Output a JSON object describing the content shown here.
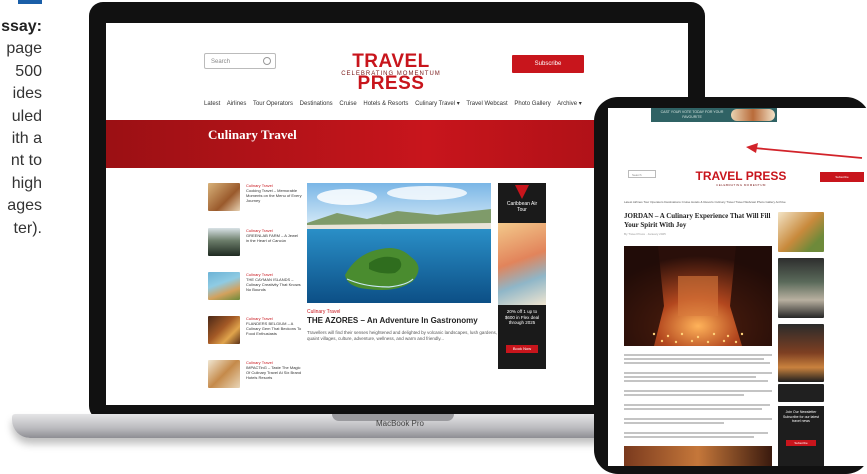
{
  "caption": {
    "lines": [
      "ssay:",
      "page",
      "500",
      "ides",
      "uled",
      "ith a",
      "nt to",
      "high",
      "ages",
      "ter)."
    ]
  },
  "laptop": {
    "model_label": "MacBook Pro",
    "screen": {
      "search_placeholder": "Search",
      "logo": "TRAVEL PRESS",
      "tagline": "CELEBRATING MOMENTUM",
      "subscribe_label": "Subscribe",
      "nav": [
        "Latest",
        "Airlines",
        "Tour Operators",
        "Destinations",
        "Cruise",
        "Hotels & Resorts",
        "Culinary Travel ▾",
        "Travel Webcast",
        "Photo Gallery",
        "Archive ▾"
      ],
      "section_title": "Culinary Travel",
      "items": [
        {
          "category": "Culinary Travel",
          "title": "Cooking Travel – Memorable Moments on the Menu of Every Journey"
        },
        {
          "category": "Culinary Travel",
          "title": "GREENLAB FARM – A Jewel in the Heart of Cancún"
        },
        {
          "category": "Culinary Travel",
          "title": "THE CAYMAN ISLANDS – Culinary Creativity That Knows No Bounds"
        },
        {
          "category": "Culinary Travel",
          "title": "FLANDERS BELGIUM – A Culinary Gem That Beckons To Food Enthusiasts"
        },
        {
          "category": "Culinary Travel",
          "title": "IMPACTinG – Taste The Magic Of Culinary Travel At Six Brand Hotels Resorts"
        }
      ],
      "article": {
        "category": "Culinary Travel",
        "title": "THE AZORES – An Adventure In Gastronomy",
        "excerpt": "Travellers will find their senses heightened and delighted by volcanic landscapes, lush gardens, quaint villages, culture, adventure, wellness, and warm and friendly..."
      },
      "ad": {
        "brand": "Caribbean Air Tour",
        "body": "20% off 1 up to $600 in Flex deal through 2025",
        "cta": "Book Now"
      }
    }
  },
  "tablet": {
    "banner_text": "CAST YOUR VOTE TODAY FOR YOUR FAVOURITE",
    "search_placeholder": "Search",
    "logo": "TRAVEL PRESS",
    "tagline": "CELEBRATING MOMENTUM",
    "subscribe_label": "Subscribe",
    "nav": "Latest Airlines Tour Operators Destinations Cruise Hotels & Resorts Culinary Travel Travel Webcast Photo Gallery Archive",
    "headline": "JORDAN – A Culinary Experience That Will Fill Your Spirit With Joy",
    "meta": "By Travel Press · January 2025",
    "side_ad_text": "Join Our Newsletter Subscribe for our latest travel news",
    "side_ad_cta": "Subscribe"
  },
  "colors": {
    "brand_red": "#c8151c",
    "arrow_red": "#d2232a",
    "device_black": "#111111",
    "caption_accent": "#1a5fa8"
  }
}
